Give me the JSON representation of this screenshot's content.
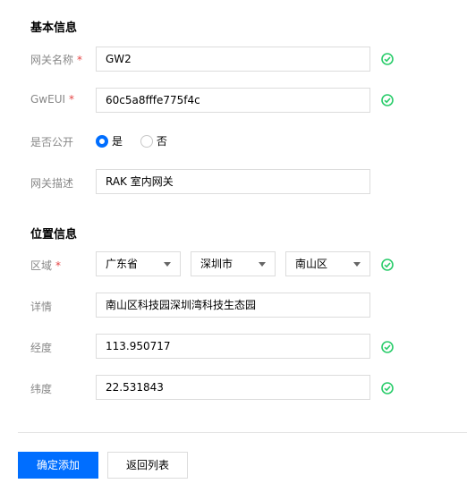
{
  "basic": {
    "title": "基本信息",
    "gateway_name": {
      "label": "网关名称",
      "required": "*",
      "value": "GW2"
    },
    "gweui": {
      "label": "GwEUI",
      "required": "*",
      "value": "60c5a8fffe775f4c"
    },
    "public": {
      "label": "是否公开",
      "yes": "是",
      "no": "否",
      "selected": "是"
    },
    "description": {
      "label": "网关描述",
      "value": "RAK 室内网关"
    }
  },
  "location": {
    "title": "位置信息",
    "region": {
      "label": "区域",
      "required": "*",
      "province": "广东省",
      "city": "深圳市",
      "district": "南山区"
    },
    "detail": {
      "label": "详情",
      "value": "南山区科技园深圳湾科技生态园"
    },
    "longitude": {
      "label": "经度",
      "value": "113.950717"
    },
    "latitude": {
      "label": "纬度",
      "value": "22.531843"
    }
  },
  "actions": {
    "confirm": "确定添加",
    "back": "返回列表"
  },
  "colors": {
    "primary": "#006eff",
    "success": "#29cc6a",
    "required": "#e54545"
  },
  "icons": {
    "valid": "check-circle-icon",
    "dropdown": "caret-down-icon"
  }
}
